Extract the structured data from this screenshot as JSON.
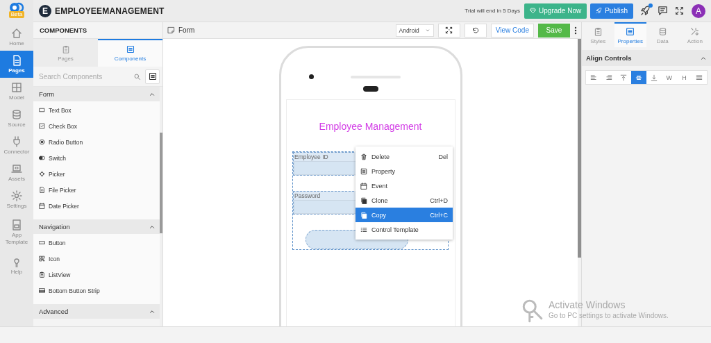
{
  "app": {
    "logo_badge": "Beta",
    "title_initial": "E",
    "title": "EMPLOYEEMANAGEMENT"
  },
  "rail": [
    {
      "label": "Home",
      "selected": false
    },
    {
      "label": "Pages",
      "selected": true
    },
    {
      "label": "Model",
      "selected": false
    },
    {
      "label": "Source",
      "selected": false
    },
    {
      "label": "Connector",
      "selected": false
    },
    {
      "label": "Assets",
      "selected": false
    },
    {
      "label": "Settings",
      "selected": false
    },
    {
      "label": "App Template",
      "selected": false
    },
    {
      "label": "Help",
      "selected": false
    }
  ],
  "top_bar": {
    "trial_notice": "Trial will end in 5 Days",
    "buttons": [
      {
        "label": "Upgrade Now",
        "kind": "upgrade"
      },
      {
        "label": "Publish",
        "kind": "publish"
      }
    ],
    "notification_dot": true,
    "avatar": "A"
  },
  "components_panel": {
    "title": "COMPONENTS",
    "tabs": [
      {
        "label": "Pages",
        "selected": false
      },
      {
        "label": "Components",
        "selected": true
      }
    ],
    "search": {
      "placeholder": "Search Components"
    },
    "sections": [
      {
        "title": "Form",
        "expanded": true,
        "items": [
          "Text Box",
          "Check Box",
          "Radio Button",
          "Switch",
          "Picker",
          "File Picker",
          "Date Picker"
        ]
      },
      {
        "title": "Navigation",
        "expanded": true,
        "items": [
          "Button",
          "Icon",
          "ListView",
          "Bottom Button Strip"
        ]
      },
      {
        "title": "Advanced",
        "expanded": true
      }
    ]
  },
  "canvas": {
    "page_name": "Form",
    "platform": "Android",
    "view_code": "View Code",
    "save": "Save",
    "screen_title": "Employee Management",
    "fields": [
      {
        "label": "Employee ID"
      },
      {
        "label": "Password"
      }
    ],
    "context_menu": [
      {
        "label": "Delete",
        "shortcut": "Del",
        "selected": false
      },
      {
        "label": "Property",
        "selected": false
      },
      {
        "label": "Event",
        "selected": false
      },
      {
        "label": "Clone",
        "shortcut": "Ctrl+D",
        "selected": false
      },
      {
        "label": "Copy",
        "shortcut": "Ctrl+C",
        "selected": true
      },
      {
        "label": "Control Template",
        "selected": false
      }
    ]
  },
  "properties_panel": {
    "tabs": [
      {
        "label": "Styles",
        "selected": false
      },
      {
        "label": "Properties",
        "selected": true
      },
      {
        "label": "Data",
        "selected": false
      },
      {
        "label": "Action",
        "selected": false
      }
    ],
    "section": {
      "title": "Align Controls",
      "expanded": true
    },
    "align_buttons": [
      {
        "kind": "icon",
        "selected": false
      },
      {
        "kind": "icon",
        "selected": false
      },
      {
        "kind": "icon",
        "selected": false
      },
      {
        "kind": "icon",
        "selected": true
      },
      {
        "kind": "icon",
        "selected": false
      },
      {
        "kind": "text",
        "label": "W",
        "selected": false
      },
      {
        "kind": "text",
        "label": "H",
        "selected": false
      },
      {
        "kind": "icon",
        "selected": false
      }
    ]
  },
  "os_notice": {
    "title": "Activate Windows",
    "message": "Go to PC settings to activate Windows."
  }
}
